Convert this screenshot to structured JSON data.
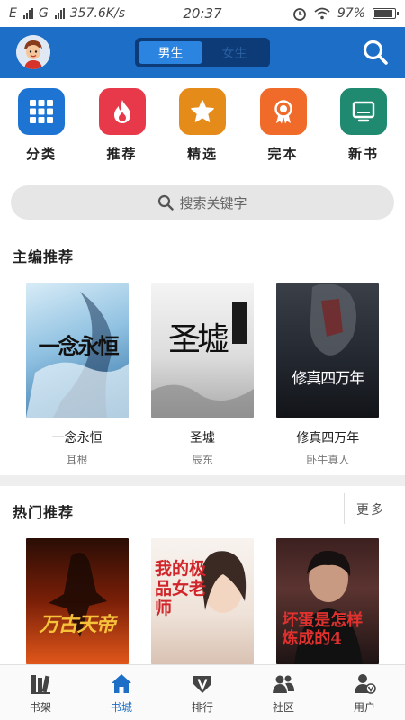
{
  "status_bar": {
    "left": "E",
    "left2": "G",
    "speed": "357.6K/s",
    "time": "20:37",
    "battery": "97%",
    "battery_level": 0.97
  },
  "header": {
    "tabs": [
      {
        "label": "男生",
        "active": true
      },
      {
        "label": "女生",
        "active": false
      }
    ],
    "icons": {
      "avatar": "avatar-icon",
      "search": "search-icon"
    }
  },
  "categories": [
    {
      "label": "分类",
      "icon": "grid-icon",
      "color": "#1e74d2"
    },
    {
      "label": "推荐",
      "icon": "flame-icon",
      "color": "#e8394b"
    },
    {
      "label": "精选",
      "icon": "star-icon",
      "color": "#e58b1a"
    },
    {
      "label": "完本",
      "icon": "medal-icon",
      "color": "#f06b2a"
    },
    {
      "label": "新书",
      "icon": "monitor-icon",
      "color": "#1f8a6f"
    }
  ],
  "search": {
    "placeholder": "搜索关键字"
  },
  "editor_picks": {
    "title": "主编推荐",
    "books": [
      {
        "title": "一念永恒",
        "author": "耳根",
        "cover_text": "一念永恒"
      },
      {
        "title": "圣墟",
        "author": "辰东",
        "cover_text": "圣墟"
      },
      {
        "title": "修真四万年",
        "author": "卧牛真人",
        "cover_text": "修真四万年"
      }
    ]
  },
  "hot_picks": {
    "title": "热门推荐",
    "more": "更多",
    "books": [
      {
        "cover_text": "万古天帝"
      },
      {
        "cover_text": "我的极品女老师"
      },
      {
        "cover_text": "坏蛋是怎样炼成的4"
      }
    ]
  },
  "tabbar": [
    {
      "label": "书架",
      "icon": "bookshelf-icon",
      "active": false
    },
    {
      "label": "书城",
      "icon": "home-icon",
      "active": true
    },
    {
      "label": "排行",
      "icon": "rank-icon",
      "active": false
    },
    {
      "label": "社区",
      "icon": "community-icon",
      "active": false
    },
    {
      "label": "用户",
      "icon": "user-icon",
      "active": false
    }
  ],
  "colors": {
    "primary": "#1c6ec7",
    "segment_dark": "#0c3b78",
    "segment_active": "#2b84df"
  }
}
